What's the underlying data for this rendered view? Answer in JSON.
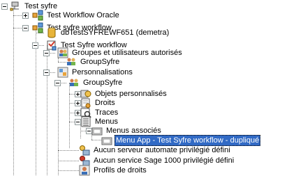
{
  "tree": {
    "nodes": [
      {
        "label": "Test syfre"
      },
      {
        "label": "Test Workflow Oracle"
      },
      {
        "label": "Test syfre workflow"
      },
      {
        "label": "dbTestSYFREWF651 (demetra)"
      },
      {
        "label": "Test Syfre workflow"
      },
      {
        "label": "Groupes et utilisateurs autorisés"
      },
      {
        "label": "GroupSyfre"
      },
      {
        "label": "Personnalisations"
      },
      {
        "label": "GroupSyfre"
      },
      {
        "label": "Objets personnalisés"
      },
      {
        "label": "Droits"
      },
      {
        "label": "Traces"
      },
      {
        "label": "Menus"
      },
      {
        "label": "Menus associés"
      },
      {
        "label": "Menu App - Test Syfre workflow - dupliqué",
        "selected": true
      },
      {
        "label": "Aucun serveur automate privilégié défini"
      },
      {
        "label": "Aucun service Sage 1000 privilégié défini"
      },
      {
        "label": "Profils de droits"
      }
    ]
  },
  "colors": {
    "selection": "#316ac5",
    "folder": "#f0c24f",
    "database": "#e7b43a"
  }
}
